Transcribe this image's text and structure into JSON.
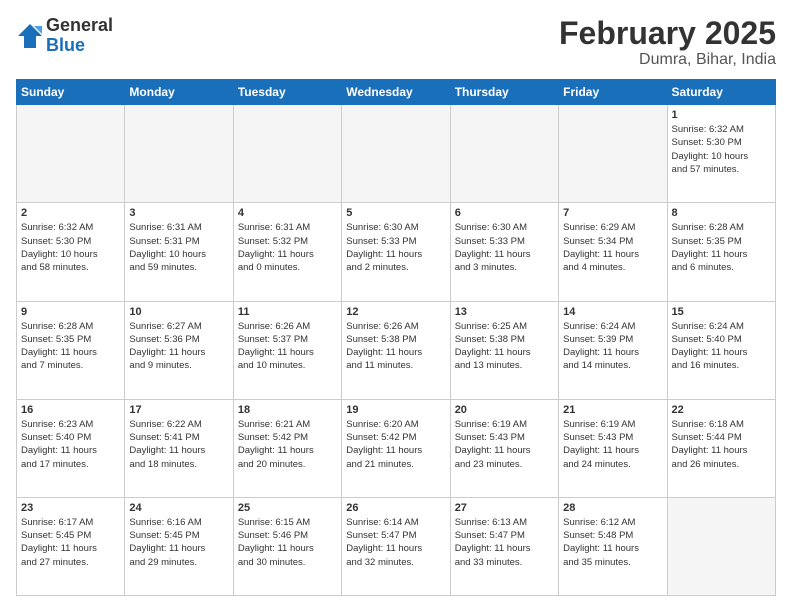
{
  "logo": {
    "general": "General",
    "blue": "Blue"
  },
  "title": "February 2025",
  "subtitle": "Dumra, Bihar, India",
  "days": [
    "Sunday",
    "Monday",
    "Tuesday",
    "Wednesday",
    "Thursday",
    "Friday",
    "Saturday"
  ],
  "weeks": [
    [
      {
        "day": "",
        "info": ""
      },
      {
        "day": "",
        "info": ""
      },
      {
        "day": "",
        "info": ""
      },
      {
        "day": "",
        "info": ""
      },
      {
        "day": "",
        "info": ""
      },
      {
        "day": "",
        "info": ""
      },
      {
        "day": "1",
        "info": "Sunrise: 6:32 AM\nSunset: 5:30 PM\nDaylight: 10 hours\nand 57 minutes."
      }
    ],
    [
      {
        "day": "2",
        "info": "Sunrise: 6:32 AM\nSunset: 5:30 PM\nDaylight: 10 hours\nand 58 minutes."
      },
      {
        "day": "3",
        "info": "Sunrise: 6:31 AM\nSunset: 5:31 PM\nDaylight: 10 hours\nand 59 minutes."
      },
      {
        "day": "4",
        "info": "Sunrise: 6:31 AM\nSunset: 5:32 PM\nDaylight: 11 hours\nand 0 minutes."
      },
      {
        "day": "5",
        "info": "Sunrise: 6:30 AM\nSunset: 5:33 PM\nDaylight: 11 hours\nand 2 minutes."
      },
      {
        "day": "6",
        "info": "Sunrise: 6:30 AM\nSunset: 5:33 PM\nDaylight: 11 hours\nand 3 minutes."
      },
      {
        "day": "7",
        "info": "Sunrise: 6:29 AM\nSunset: 5:34 PM\nDaylight: 11 hours\nand 4 minutes."
      },
      {
        "day": "8",
        "info": "Sunrise: 6:28 AM\nSunset: 5:35 PM\nDaylight: 11 hours\nand 6 minutes."
      }
    ],
    [
      {
        "day": "9",
        "info": "Sunrise: 6:28 AM\nSunset: 5:35 PM\nDaylight: 11 hours\nand 7 minutes."
      },
      {
        "day": "10",
        "info": "Sunrise: 6:27 AM\nSunset: 5:36 PM\nDaylight: 11 hours\nand 9 minutes."
      },
      {
        "day": "11",
        "info": "Sunrise: 6:26 AM\nSunset: 5:37 PM\nDaylight: 11 hours\nand 10 minutes."
      },
      {
        "day": "12",
        "info": "Sunrise: 6:26 AM\nSunset: 5:38 PM\nDaylight: 11 hours\nand 11 minutes."
      },
      {
        "day": "13",
        "info": "Sunrise: 6:25 AM\nSunset: 5:38 PM\nDaylight: 11 hours\nand 13 minutes."
      },
      {
        "day": "14",
        "info": "Sunrise: 6:24 AM\nSunset: 5:39 PM\nDaylight: 11 hours\nand 14 minutes."
      },
      {
        "day": "15",
        "info": "Sunrise: 6:24 AM\nSunset: 5:40 PM\nDaylight: 11 hours\nand 16 minutes."
      }
    ],
    [
      {
        "day": "16",
        "info": "Sunrise: 6:23 AM\nSunset: 5:40 PM\nDaylight: 11 hours\nand 17 minutes."
      },
      {
        "day": "17",
        "info": "Sunrise: 6:22 AM\nSunset: 5:41 PM\nDaylight: 11 hours\nand 18 minutes."
      },
      {
        "day": "18",
        "info": "Sunrise: 6:21 AM\nSunset: 5:42 PM\nDaylight: 11 hours\nand 20 minutes."
      },
      {
        "day": "19",
        "info": "Sunrise: 6:20 AM\nSunset: 5:42 PM\nDaylight: 11 hours\nand 21 minutes."
      },
      {
        "day": "20",
        "info": "Sunrise: 6:19 AM\nSunset: 5:43 PM\nDaylight: 11 hours\nand 23 minutes."
      },
      {
        "day": "21",
        "info": "Sunrise: 6:19 AM\nSunset: 5:43 PM\nDaylight: 11 hours\nand 24 minutes."
      },
      {
        "day": "22",
        "info": "Sunrise: 6:18 AM\nSunset: 5:44 PM\nDaylight: 11 hours\nand 26 minutes."
      }
    ],
    [
      {
        "day": "23",
        "info": "Sunrise: 6:17 AM\nSunset: 5:45 PM\nDaylight: 11 hours\nand 27 minutes."
      },
      {
        "day": "24",
        "info": "Sunrise: 6:16 AM\nSunset: 5:45 PM\nDaylight: 11 hours\nand 29 minutes."
      },
      {
        "day": "25",
        "info": "Sunrise: 6:15 AM\nSunset: 5:46 PM\nDaylight: 11 hours\nand 30 minutes."
      },
      {
        "day": "26",
        "info": "Sunrise: 6:14 AM\nSunset: 5:47 PM\nDaylight: 11 hours\nand 32 minutes."
      },
      {
        "day": "27",
        "info": "Sunrise: 6:13 AM\nSunset: 5:47 PM\nDaylight: 11 hours\nand 33 minutes."
      },
      {
        "day": "28",
        "info": "Sunrise: 6:12 AM\nSunset: 5:48 PM\nDaylight: 11 hours\nand 35 minutes."
      },
      {
        "day": "",
        "info": ""
      }
    ]
  ]
}
